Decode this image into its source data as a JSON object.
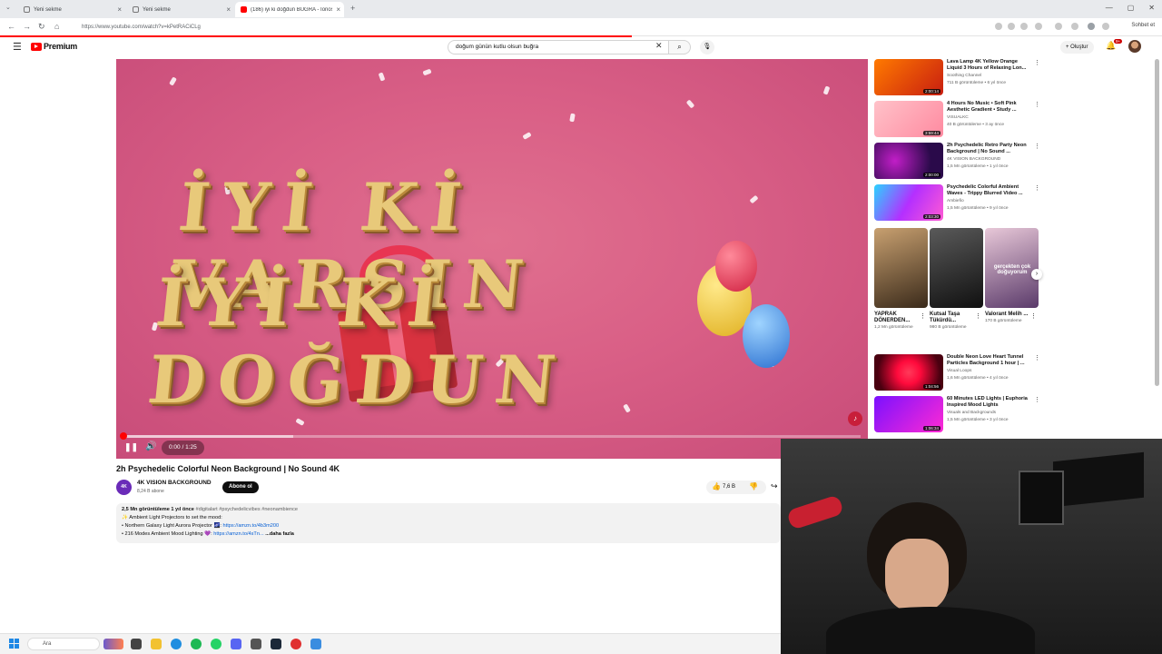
{
  "browser": {
    "tabs": [
      {
        "label": "Yeni sekme",
        "active": false
      },
      {
        "label": "Yeni sekme",
        "active": false
      },
      {
        "label": "(186) iyi ki doğdun BUĞRA - Ionos",
        "active": true
      }
    ],
    "url": "https://www.youtube.com/watch?v=kPetRACiCLg",
    "chat_label": "Sohbet et"
  },
  "header": {
    "logo": "Premium",
    "search_query": "doğum günün kutlu olsun buğra",
    "create_label": "Oluştur",
    "notifications": "9+"
  },
  "player": {
    "time": "0:00 / 1:25",
    "progress_fraction": 0.0,
    "buffer_fraction": 0.23,
    "line1": "İYİ Kİ VARSIN",
    "line2": "İYİ Kİ DOĞDUN"
  },
  "video": {
    "title": "2h Psychedelic Colorful Neon Background | No Sound 4K",
    "channel": "4K VISION BACKGROUND",
    "channel_avatar": "4K",
    "subscribers": "8,24 B abone",
    "subscribe_label": "Abone ol",
    "likes": "7,6 B",
    "description": {
      "stats": "2,5 Mn görüntüleme  1 yıl önce",
      "tags": "#digitalart #psychedelicvibes #neonambience",
      "line2": "✨ Ambient Light Projectors to set the mood:",
      "line3_text": "• Northern Galaxy Light Aurora Projector 🌌: ",
      "line3_link": "https://amzn.to/4b3m200",
      "line4_text": "• 216 Modes Ambient Mood Lighting 💜: ",
      "line4_link": "https://amzn.to/4sTn...",
      "more": "...daha fazla"
    }
  },
  "recommendations": [
    {
      "title": "Lava Lamp 4K Yellow Orange Liquid 3 Hours of Relaxing Lon...",
      "channel": "Soothing Channel",
      "meta": "711 B görüntüleme • 6 yıl önce",
      "duration": "2:00:14",
      "color1": "#ff7a00",
      "color2": "#c81e10"
    },
    {
      "title": "4 Hours No Music • Soft Pink Aesthetic Gradient • Study ...",
      "channel": "VISUALKC",
      "meta": "40 B görüntüleme • 3 ay önce",
      "duration": "3:59:44",
      "color1": "#ffc2c9",
      "color2": "#ff8aa0"
    },
    {
      "title": "2h Psychedelic Retro Party Neon Background | No Sound ...",
      "channel": "4K VISION BACKGROUND",
      "meta": "1,5 Mn görüntüleme • 1 yıl önce",
      "duration": "2:00:00",
      "color1": "#2a0a4a",
      "color2": "#c21ec8"
    },
    {
      "title": "Psychedelic Colorful Ambient Waves - Trippy Blurred Video ...",
      "channel": "Ambiefio",
      "meta": "1,5 Mn görüntüleme • 9 yıl önce",
      "duration": "2:03:30",
      "color1": "#2ad4ff",
      "color2": "#b42fff"
    },
    {
      "title": "Double Neon Love Heart Tunnel Particles Background 1 hour | ...",
      "channel": "Visual Loops",
      "meta": "1,6 Mn görüntüleme • 4 yıl önce",
      "duration": "1:04:56",
      "color1": "#ff0a3c",
      "color2": "#4a0010"
    },
    {
      "title": "60 Minutes LED Lights | Euphoria Inspired Mood Lights",
      "channel": "Visuals and Backgrounds",
      "meta": "1,5 Mn görüntüleme • 3 yıl önce",
      "duration": "1:06:34",
      "color1": "#7a10ff",
      "color2": "#ff2ad4"
    }
  ],
  "shorts": [
    {
      "title": "YAPRAK DÖNERDEN...",
      "views": "1,2 Mn görüntüleme",
      "color1": "#8a6a3a",
      "color2": "#3a2a1a"
    },
    {
      "title": "Kutsal Taşa Tükürdü...",
      "views": "980 B görüntüleme",
      "color1": "#2a2a2a",
      "color2": "#101010"
    },
    {
      "title": "Valorant Melih ...",
      "views": "170 B görüntüleme",
      "color1": "#c8a8c8",
      "color2": "#5a3a6a",
      "overlay": "gerçekten çok doğuyorum"
    }
  ],
  "taskbar": {
    "search_placeholder": "Ara"
  }
}
